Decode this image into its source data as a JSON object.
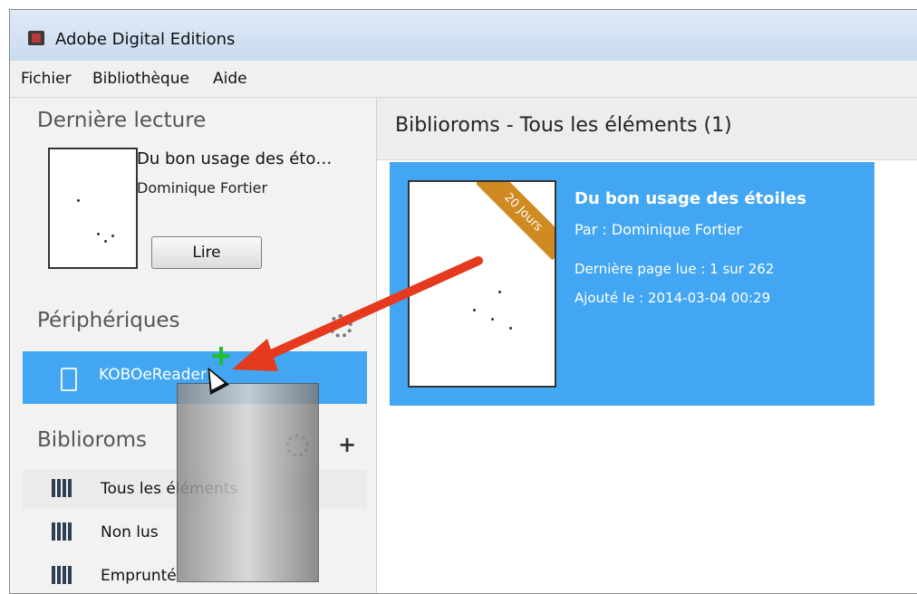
{
  "window": {
    "title": "Adobe Digital Editions"
  },
  "menu": {
    "items": [
      "Fichier",
      "Bibliothèque",
      "Aide"
    ]
  },
  "sidebar": {
    "recent": {
      "heading": "Dernière lecture",
      "book_title": "Du bon usage des éto…",
      "author": "Dominique Fortier",
      "read_button": "Lire"
    },
    "devices": {
      "heading": "Périphériques",
      "device_label": "KOBOeReader"
    },
    "shelves": {
      "heading": "Biblioroms",
      "items": [
        "Tous les éléments",
        "Non lus",
        "Emprunté"
      ]
    }
  },
  "main": {
    "header": "Biblioroms - Tous les éléments (1)",
    "book": {
      "title": "Du bon usage des étoiles",
      "author_line": "Par : Dominique Fortier",
      "last_page": "Dernière page lue : 1 sur 262",
      "added": "Ajouté le : 2014-03-04 00:29",
      "ribbon": "20 Jours"
    }
  },
  "colors": {
    "accent": "#42a6f2",
    "ribbon": "#d08a22",
    "arrow": "#e53a1e",
    "plus": "#1fbf2a"
  },
  "icons": [
    "app-icon",
    "gear-icon",
    "add-icon",
    "ereader-icon",
    "bookshelf-icon",
    "plus-icon",
    "cursor-icon",
    "arrow-icon"
  ]
}
